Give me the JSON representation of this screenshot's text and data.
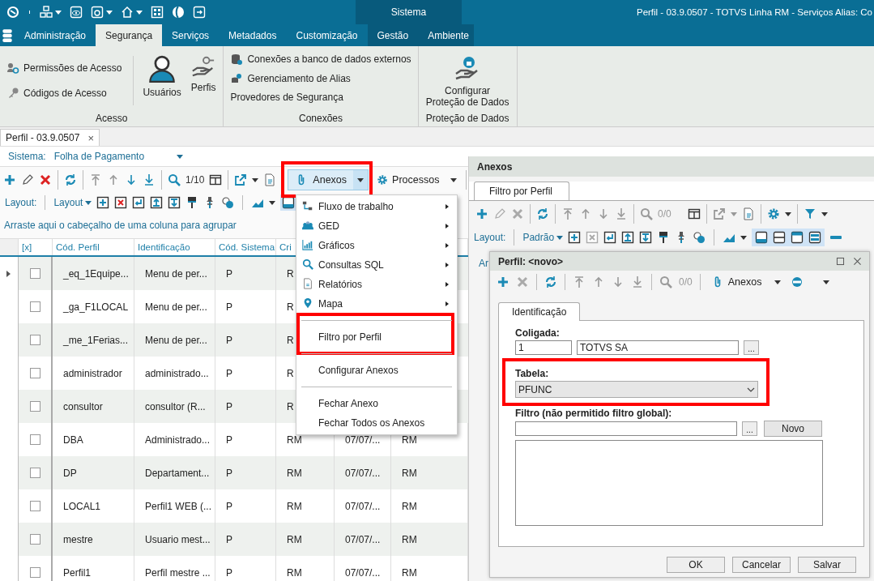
{
  "top_bar": {
    "context_label": "Sistema",
    "title": "Perfil - 03.9.0507 - TOTVS Linha RM - Serviços  Alias: Co"
  },
  "ribbon_tabs": [
    {
      "label": "Administração",
      "selected": false
    },
    {
      "label": "Segurança",
      "selected": true
    },
    {
      "label": "Serviços",
      "selected": false
    },
    {
      "label": "Metadados",
      "selected": false
    },
    {
      "label": "Customização",
      "selected": false
    }
  ],
  "context_tabs": [
    {
      "label": "Gestão",
      "selected": false
    },
    {
      "label": "Ambiente",
      "selected": false
    }
  ],
  "ribbon_groups": [
    {
      "label": "Acesso",
      "items": [
        {
          "label": "Permissões de Acesso",
          "kind": "small"
        },
        {
          "label": "Códigos de Acesso",
          "kind": "small"
        },
        {
          "label": "Usuários",
          "kind": "large"
        },
        {
          "label": "Perfis",
          "kind": "large"
        }
      ]
    },
    {
      "label": "Conexões",
      "items": [
        {
          "label": "Conexões a banco de dados externos",
          "kind": "small"
        },
        {
          "label": "Gerenciamento de Alias",
          "kind": "small"
        },
        {
          "label": "Provedores de Segurança",
          "kind": "plain"
        }
      ]
    },
    {
      "label": "Proteção de Dados",
      "items": [
        {
          "label": "Configurar\nProteção de Dados",
          "kind": "large"
        }
      ]
    }
  ],
  "document_tab": {
    "label": "Perfil - 03.9.0507",
    "close": "×"
  },
  "system_filter": {
    "label": "Sistema:",
    "value": "Folha de Pagamento"
  },
  "toolbar": {
    "record_counter": "1/10",
    "attachments_button": "Anexos",
    "processes_button": "Processos"
  },
  "layout_bar": {
    "label": "Layout:",
    "layout_button": "Layout"
  },
  "group_hint": "Arraste aqui o cabeçalho de uma coluna para agrupar",
  "grid": {
    "checkbox_header": "[x]",
    "columns": [
      "Cód. Perfil",
      "Identificação",
      "Cód. Sistema",
      "Cri"
    ],
    "rows": [
      {
        "current": true,
        "checked": false,
        "cells": [
          "_eq_1Equipe...",
          "Menu de per...",
          "P",
          "R"
        ]
      },
      {
        "current": false,
        "checked": false,
        "cells": [
          "_ga_F1LOCAL",
          "Menu de per...",
          "P",
          "R"
        ]
      },
      {
        "current": false,
        "checked": false,
        "cells": [
          "_me_1Ferias...",
          "Menu de per...",
          "P",
          "R"
        ]
      },
      {
        "current": false,
        "checked": false,
        "cells": [
          "administrador",
          "administrado...",
          "P",
          "R"
        ]
      },
      {
        "current": false,
        "checked": false,
        "cells": [
          "consultor",
          "consultor (R...",
          "P",
          "R"
        ]
      },
      {
        "current": false,
        "checked": false,
        "cells": [
          "DBA",
          "Administrado...",
          "P",
          "RM",
          "07/07/...",
          "RM"
        ]
      },
      {
        "current": false,
        "checked": false,
        "cells": [
          "DP",
          "Departament...",
          "P",
          "RM",
          "07/07/...",
          "RM"
        ]
      },
      {
        "current": false,
        "checked": false,
        "cells": [
          "LOCAL1",
          "Perfil1 WEB (...",
          "P",
          "RM",
          "07/07/...",
          "RM"
        ]
      },
      {
        "current": false,
        "checked": false,
        "cells": [
          "mestre",
          "Usuario mest...",
          "P",
          "RM",
          "07/07/...",
          "RM"
        ]
      },
      {
        "current": false,
        "checked": false,
        "cells": [
          "Perfil1",
          "Perfil mestre ...",
          "P",
          "RM",
          "07/07/...",
          "RM"
        ]
      }
    ]
  },
  "attachments_menu": {
    "items": [
      {
        "kind": "submenu",
        "label": "Fluxo de trabalho"
      },
      {
        "kind": "submenu",
        "label": "GED"
      },
      {
        "kind": "submenu",
        "label": "Gráficos"
      },
      {
        "kind": "submenu",
        "label": "Consultas SQL"
      },
      {
        "kind": "submenu",
        "label": "Relatórios"
      },
      {
        "kind": "submenu",
        "label": "Mapa"
      },
      {
        "kind": "separator"
      },
      {
        "kind": "command",
        "label": "Filtro por Perfil"
      },
      {
        "kind": "separator"
      },
      {
        "kind": "command",
        "label": "Configurar Anexos"
      },
      {
        "kind": "separator"
      },
      {
        "kind": "command",
        "label": "Fechar Anexo"
      },
      {
        "kind": "command",
        "label": "Fechar Todos os Anexos"
      }
    ]
  },
  "anexos_window": {
    "title": "Anexos",
    "tab": "Filtro por Perfil",
    "record_counter": "0/0",
    "layout_label": "Layout:",
    "layout_button": "Padrão",
    "group_hint": "Ar"
  },
  "perfil_dialog": {
    "title": "Perfil: <novo>",
    "record_counter": "0/0",
    "attachments_button": "Anexos",
    "tab": "Identificação",
    "coligada": {
      "label": "Coligada:",
      "code": "1",
      "name": "TOTVS SA",
      "browse": "..."
    },
    "tabela": {
      "label": "Tabela:",
      "value": "PFUNC"
    },
    "filtro": {
      "label": "Filtro (não permitido filtro global):",
      "browse": "...",
      "new_button": "Novo"
    },
    "buttons": [
      "OK",
      "Cancelar",
      "Salvar"
    ]
  }
}
